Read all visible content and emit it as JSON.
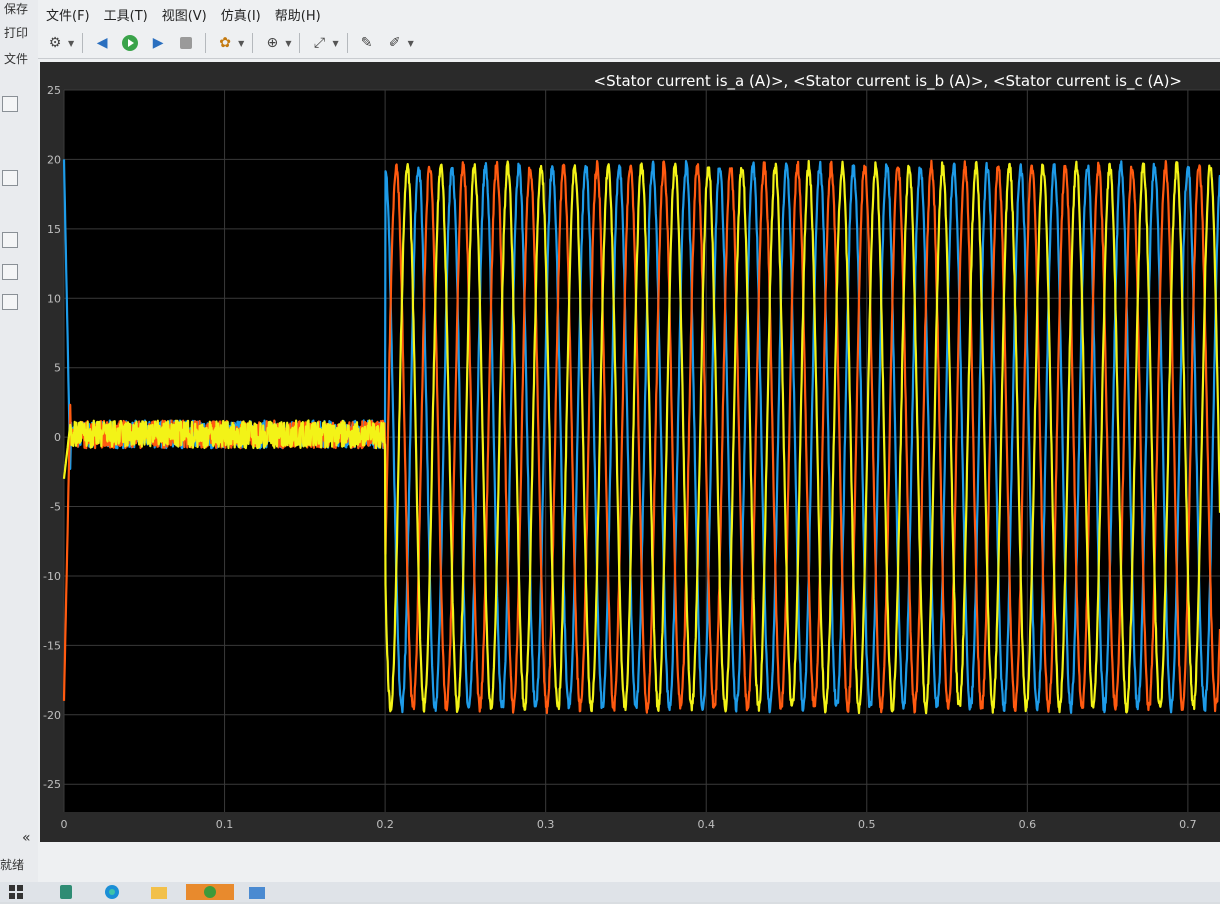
{
  "background_app": {
    "items": [
      "保存",
      "打印",
      "文件"
    ],
    "status": "就绪",
    "collapse_icon": "double-chevron-left-icon"
  },
  "menu": [
    "文件(F)",
    "工具(T)",
    "视图(V)",
    "仿真(I)",
    "帮助(H)"
  ],
  "toolbar_icons": [
    "settings-icon",
    "step-back-icon",
    "run-icon",
    "step-forward-icon",
    "stop-icon",
    "highlight-icon",
    "zoom-icon",
    "fit-icon",
    "style-icon",
    "edit-icon"
  ],
  "scope": {
    "title": "<Stator current is_a (A)>, <Stator current is_b (A)>, <Stator current is_c (A)>",
    "status": "就绪"
  },
  "colors": {
    "phase_a": "#1e9be8",
    "phase_b": "#ff5a10",
    "phase_c": "#f3f317",
    "plot_bg": "#000000",
    "frame": "#2a2a2a"
  },
  "chart_data": {
    "type": "line",
    "title": "<Stator current is_a (A)>, <Stator current is_b (A)>, <Stator current is_c (A)>",
    "xlim": [
      0,
      0.72
    ],
    "ylim": [
      -27,
      25
    ],
    "x_ticks": [
      "0",
      "0.1",
      "0.2",
      "0.3",
      "0.4",
      "0.5",
      "0.6",
      "0.7"
    ],
    "y_ticks": [
      "25",
      "20",
      "15",
      "10",
      "5",
      "0",
      "-5",
      "-10",
      "-15",
      "-20",
      "-25"
    ],
    "grid": true,
    "phase_amplitude": 19.5,
    "frequency_hz": 48,
    "step_time": 0.2,
    "series": [
      {
        "color": "#1e9be8",
        "phase_deg": 90
      },
      {
        "color": "#ff5a10",
        "phase_deg": -30
      },
      {
        "color": "#f3f317",
        "phase_deg": 210
      }
    ]
  }
}
